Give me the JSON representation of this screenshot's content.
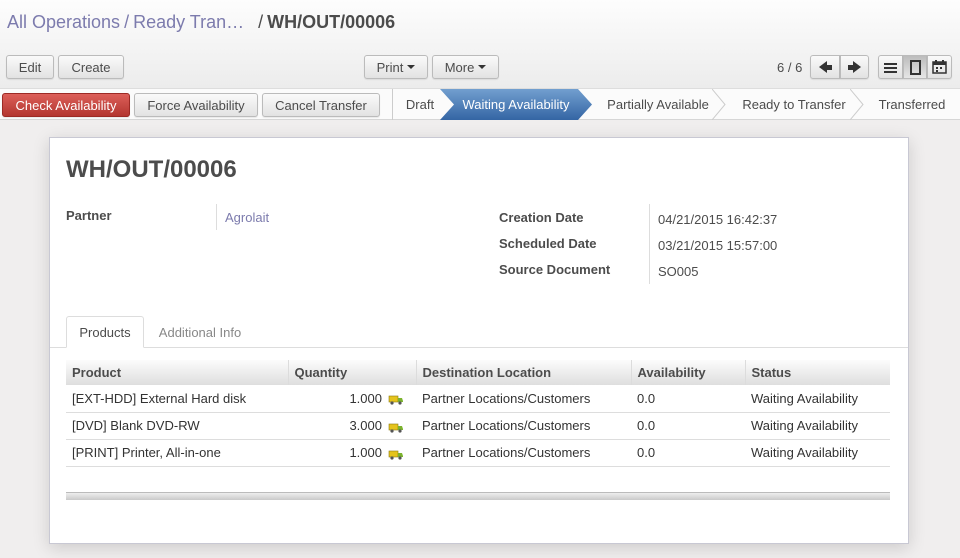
{
  "breadcrumb": {
    "items": [
      "All Operations",
      "Ready Tran…"
    ],
    "separator": "/",
    "current": "WH/OUT/00006"
  },
  "toolbar": {
    "edit": "Edit",
    "create": "Create",
    "print": "Print",
    "more": "More",
    "pager": "6 / 6"
  },
  "actions": {
    "check_availability": "Check Availability",
    "force_availability": "Force Availability",
    "cancel_transfer": "Cancel Transfer"
  },
  "stages": [
    "Draft",
    "Waiting Availability",
    "Partially Available",
    "Ready to Transfer",
    "Transferred"
  ],
  "active_stage": "Waiting Availability",
  "record": {
    "title": "WH/OUT/00006",
    "partner_label": "Partner",
    "partner": "Agrolait",
    "creation_date_label": "Creation Date",
    "creation_date": "04/21/2015 16:42:37",
    "scheduled_date_label": "Scheduled Date",
    "scheduled_date": "03/21/2015 15:57:00",
    "source_document_label": "Source Document",
    "source_document": "SO005"
  },
  "tabs": [
    "Products",
    "Additional Info"
  ],
  "table": {
    "columns": [
      "Product",
      "Quantity",
      "Destination Location",
      "Availability",
      "Status"
    ],
    "rows": [
      [
        "[EXT-HDD] External Hard disk",
        "1.000",
        "Partner Locations/Customers",
        "0.0",
        "Waiting Availability"
      ],
      [
        "[DVD] Blank DVD-RW",
        "3.000",
        "Partner Locations/Customers",
        "0.0",
        "Waiting Availability"
      ],
      [
        "[PRINT] Printer, All-in-one",
        "1.000",
        "Partner Locations/Customers",
        "0.0",
        "Waiting Availability"
      ]
    ]
  },
  "colors": {
    "primary": "#c9302c",
    "active_stage": "#3d6eaf",
    "link": "#7c7bad"
  },
  "icons": {
    "row_action": "truck-icon",
    "prev": "arrow-left-icon",
    "next": "arrow-right-icon"
  }
}
